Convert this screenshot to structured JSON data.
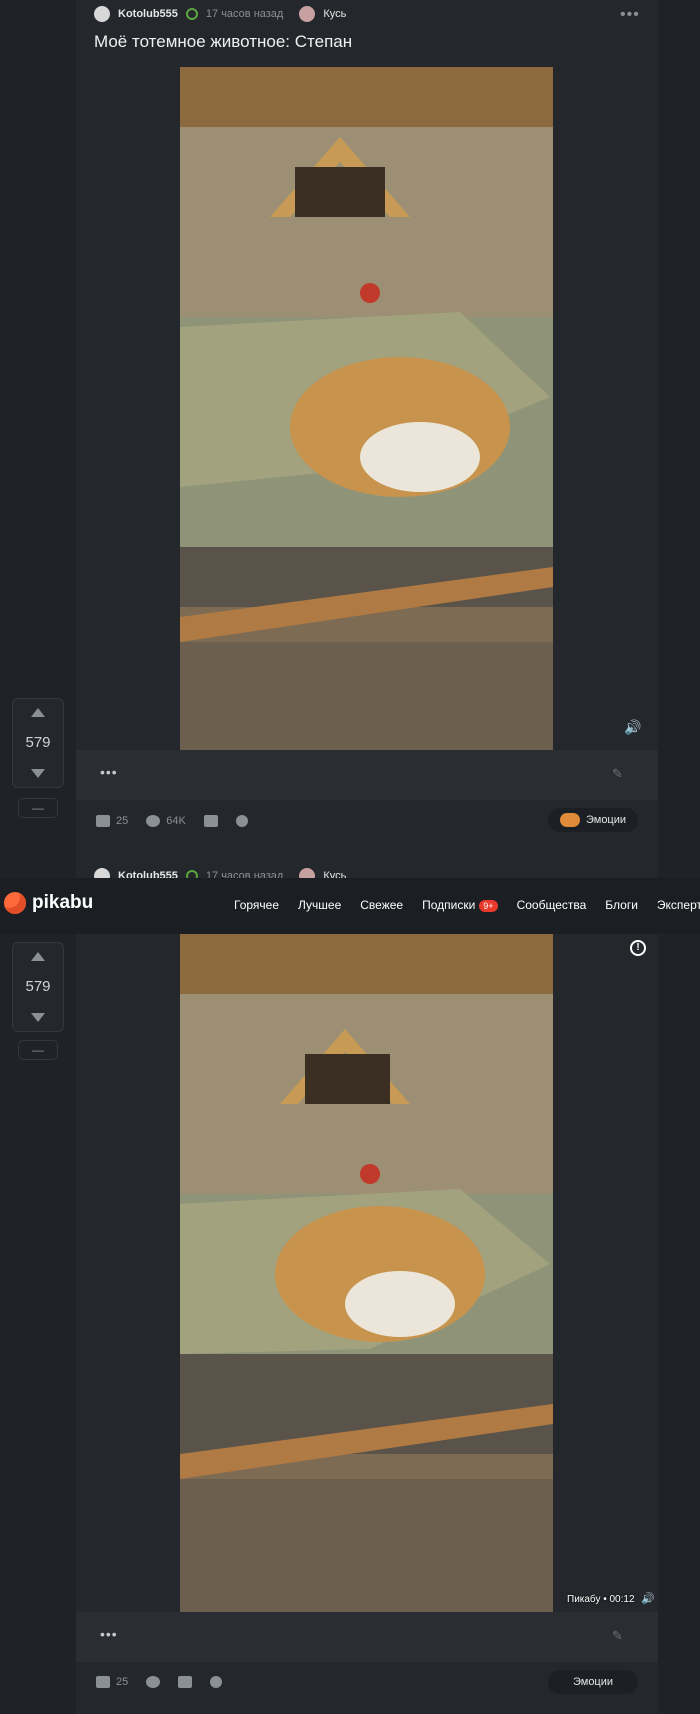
{
  "post1": {
    "author": "Kotolub555",
    "time": "17 часов назад",
    "community": "Кусь",
    "title": "Моё тотемное животное: Степан",
    "rating": "579",
    "minus": "—",
    "comments": "25",
    "views": "64K",
    "emotions": "Эмоции"
  },
  "post2_header": {
    "author": "Kotolub555",
    "time": "17 часов назад",
    "community": "Кусь"
  },
  "nav": {
    "logo": "pikabu",
    "items": [
      "Горячее",
      "Лучшее",
      "Свежее",
      "Подписки",
      "Сообщества",
      "Блоги",
      "Эксперт"
    ],
    "subs_badge": "9+"
  },
  "post2": {
    "rating": "579",
    "minus": "—",
    "video_meta": "Пикабу • 00:12",
    "comments": "25",
    "emotions": "Эмоции"
  },
  "colors": {
    "accent": "#5ba43f",
    "badge": "#e8392c",
    "logo": "#ff6a3d"
  },
  "icons": [
    "avatar-icon",
    "verified-icon",
    "more-icon",
    "sound-icon",
    "comment-icon",
    "eye-icon",
    "save-icon",
    "share-icon",
    "pencil-icon",
    "info-icon",
    "up-arrow-icon",
    "down-arrow-icon"
  ]
}
